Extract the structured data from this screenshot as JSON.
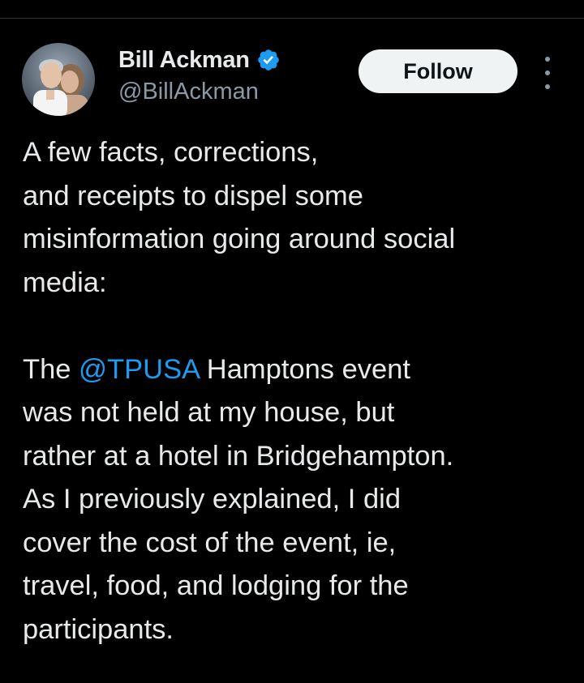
{
  "author": {
    "display_name": "Bill Ackman",
    "handle": "@BillAckman",
    "verified": true
  },
  "actions": {
    "follow_label": "Follow",
    "more_icon": "more-vertical-icon"
  },
  "tweet": {
    "paragraph1_lines": [
      "A few facts, corrections,",
      "and receipts to dispel some",
      "misinformation going around social",
      "media:"
    ],
    "paragraph2_prefix": "The",
    "mention": "@TPUSA",
    "paragraph2_line1_suffix": "Hamptons event",
    "paragraph2_lines": [
      "was not held at my house, but",
      "rather at a hotel in Bridgehampton.",
      "As I previously explained, I did",
      "cover the cost of the event, ie,",
      "travel, food, and lodging for the",
      "participants."
    ]
  },
  "colors": {
    "background": "#000000",
    "text": "#e7e9ea",
    "secondary": "#8b98a5",
    "link": "#1d9bf0",
    "verified_badge": "#1d9bf0",
    "follow_bg": "#eff3f4"
  }
}
